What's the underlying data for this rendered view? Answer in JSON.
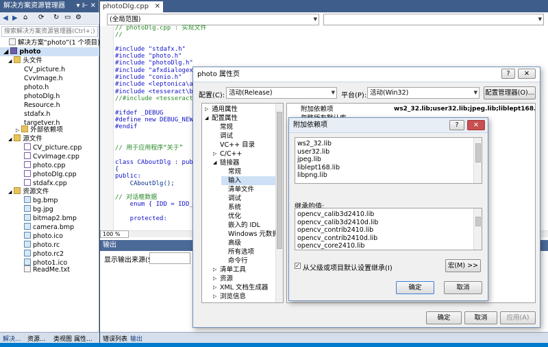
{
  "solution_explorer": {
    "title": "解决方案资源管理器",
    "pin_icons": "▾ ⊩ ✕",
    "search_placeholder": "搜索解决方案资源管理器(Ctrl+;)",
    "solution_label": "解决方案“photo”(1 个项目)",
    "project": "photo",
    "folders": {
      "headers": "头文件",
      "external": "外部依赖项",
      "sources": "源文件",
      "resources": "资源文件"
    },
    "header_files": [
      "CV_picture.h",
      "CvvImage.h",
      "photo.h",
      "photoDlg.h",
      "Resource.h",
      "stdafx.h",
      "targetver.h"
    ],
    "source_files": [
      "CV_picture.cpp",
      "CvvImage.cpp",
      "photo.cpp",
      "photoDlg.cpp",
      "stdafx.cpp"
    ],
    "resource_files": [
      "bg.bmp",
      "bg.jpg",
      "bitmap2.bmp",
      "camera.bmp",
      "photo.ico",
      "photo.rc",
      "photo.rc2",
      "photo1.ico"
    ],
    "readme": "ReadMe.txt",
    "bottom_tabs": [
      "解决...",
      "资源...",
      "类视图",
      "属性..."
    ]
  },
  "editor": {
    "tab": "photoDlg.cpp",
    "scope": "(全局范围)",
    "zoom": "100 %",
    "lines": [
      "// photoDlg.cpp : 实现文件",
      "//",
      "",
      "#include \"stdafx.h\"",
      "#include \"photo.h\"",
      "#include \"photoDlg.h\"",
      "#include \"afxdialogex.h\"",
      "#include \"conio.h\"",
      "#include <leptonica\\all",
      "#include <tesseract\\bas",
      "//#include <tesseract\\s",
      "",
      "#ifdef _DEBUG",
      "#define new DEBUG_NEW",
      "#endif",
      "",
      "",
      "// 用于应用程序“关于”",
      "",
      "class CAboutDlg : public",
      "{",
      "public:",
      "    CAboutDlg();",
      "",
      "// 对话框数据",
      "    enum { IDD = IDD_AB",
      "",
      "    protected:"
    ]
  },
  "output": {
    "title": "输出",
    "source_label": "显示输出来源(S):",
    "tabs": [
      "错误列表",
      "输出"
    ]
  },
  "property_dialog": {
    "title": "photo 属性页",
    "config_label": "配置(C):",
    "config_value": "活动(Release)",
    "platform_label": "平台(P):",
    "platform_value": "活动(Win32)",
    "config_manager": "配置管理器(O)...",
    "tree": [
      "通用属性",
      "配置属性",
      "常规",
      "调试",
      "VC++ 目录",
      "C/C++",
      "链接器",
      "常规",
      "输入",
      "清单文件",
      "调试",
      "系统",
      "优化",
      "嵌入的 IDL",
      "Windows 元数据",
      "高级",
      "所有选项",
      "命令行",
      "清单工具",
      "资源",
      "XML 文档生成器",
      "浏览信息"
    ],
    "prop_names": [
      "附加依赖项",
      "忽略所有默认库"
    ],
    "prop_value": "ws2_32.lib;user32.lib;jpeg.lib;liblept168.lib;libpng.l",
    "ok": "确定",
    "cancel": "取消",
    "apply": "应用(A)"
  },
  "deps_dialog": {
    "title": "附加依赖项",
    "items": [
      "ws2_32.lib",
      "user32.lib",
      "jpeg.lib",
      "liblept168.lib",
      "libpng.lib"
    ],
    "inherited_label": "继承的值:",
    "inherited": [
      "opencv_calib3d2410.lib",
      "opencv_calib3d2410d.lib",
      "opencv_contrib2410.lib",
      "opencv_contrib2410d.lib",
      "opencv_core2410.lib"
    ],
    "inherit_checkbox": "从父级或项目默认设置继承(I)",
    "macro": "宏(M) >>",
    "ok": "确定",
    "cancel": "取消",
    "help": "?"
  },
  "colors": {
    "titlebar": "#3f5d8a",
    "chrome": "#293955",
    "dialog": "#f0f0f0",
    "selection": "#cde0f5"
  }
}
